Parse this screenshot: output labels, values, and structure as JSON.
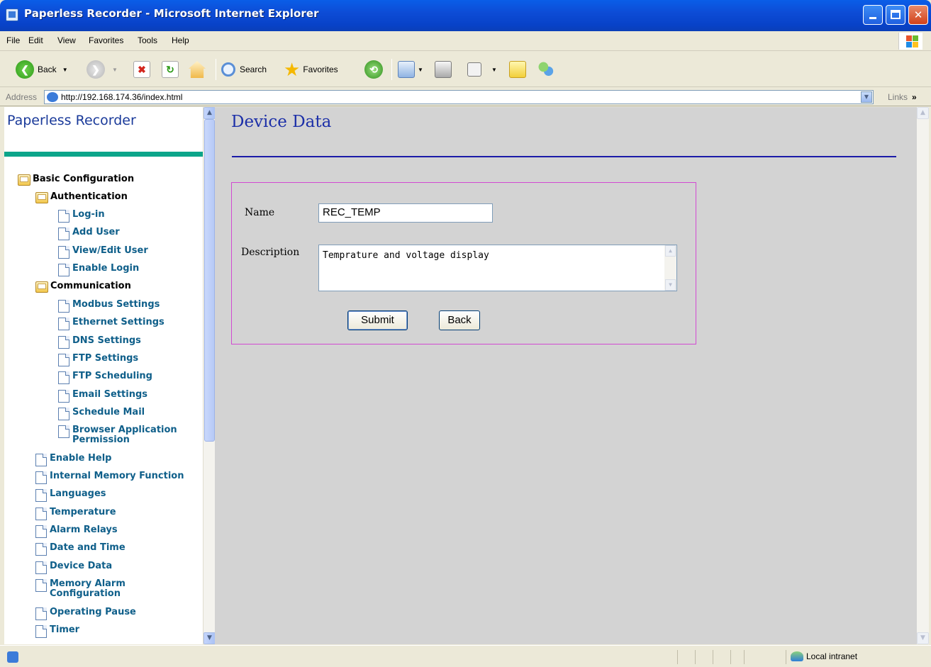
{
  "window": {
    "title": "Paperless Recorder - Microsoft Internet Explorer"
  },
  "menu": [
    "File",
    "Edit",
    "View",
    "Favorites",
    "Tools",
    "Help"
  ],
  "toolbar": {
    "back_label": "Back",
    "search_label": "Search",
    "favorites_label": "Favorites"
  },
  "address": {
    "label": "Address",
    "url": "http://192.168.174.36/index.html",
    "links_label": "Links"
  },
  "sidebar": {
    "brand": "Paperless Recorder",
    "items": [
      {
        "label": "Basic Configuration",
        "type": "folder",
        "indent": 0
      },
      {
        "label": "Authentication",
        "type": "folder",
        "indent": 1
      },
      {
        "label": "Log-in",
        "type": "page",
        "indent": 2
      },
      {
        "label": "Add User",
        "type": "page",
        "indent": 2
      },
      {
        "label": "View/Edit User",
        "type": "page",
        "indent": 2
      },
      {
        "label": "Enable Login",
        "type": "page",
        "indent": 2
      },
      {
        "label": "Communication",
        "type": "folder",
        "indent": 1
      },
      {
        "label": "Modbus Settings",
        "type": "page",
        "indent": 2
      },
      {
        "label": "Ethernet Settings",
        "type": "page",
        "indent": 2
      },
      {
        "label": "DNS Settings",
        "type": "page",
        "indent": 2
      },
      {
        "label": "FTP Settings",
        "type": "page",
        "indent": 2
      },
      {
        "label": "FTP Scheduling",
        "type": "page",
        "indent": 2
      },
      {
        "label": "Email Settings",
        "type": "page",
        "indent": 2
      },
      {
        "label": "Schedule Mail",
        "type": "page",
        "indent": 2
      },
      {
        "label": "Browser Application\nPermission",
        "type": "page",
        "indent": 2
      },
      {
        "label": "Enable Help",
        "type": "page",
        "indent": 1
      },
      {
        "label": "Internal Memory Function",
        "type": "page",
        "indent": 1
      },
      {
        "label": "Languages",
        "type": "page",
        "indent": 1
      },
      {
        "label": "Temperature",
        "type": "page",
        "indent": 1
      },
      {
        "label": "Alarm Relays",
        "type": "page",
        "indent": 1
      },
      {
        "label": "Date and Time",
        "type": "page",
        "indent": 1
      },
      {
        "label": "Device Data",
        "type": "page",
        "indent": 1
      },
      {
        "label": "Memory Alarm\nConfiguration",
        "type": "page",
        "indent": 1
      },
      {
        "label": "Operating Pause",
        "type": "page",
        "indent": 1
      },
      {
        "label": "Timer",
        "type": "page",
        "indent": 1
      }
    ]
  },
  "main": {
    "heading": "Device Data",
    "form": {
      "name_label": "Name",
      "name_value": "REC_TEMP",
      "description_label": "Description",
      "description_value": "Temprature and voltage display",
      "submit_label": "Submit",
      "back_label": "Back"
    }
  },
  "status": {
    "zone": "Local intranet"
  },
  "colors": {
    "heading": "#1c2fa8",
    "sidebar_link": "#0f5f8a",
    "accent_bar": "#0ca58a",
    "form_border": "#d24ad2",
    "content_bg": "#d3d3d3"
  }
}
